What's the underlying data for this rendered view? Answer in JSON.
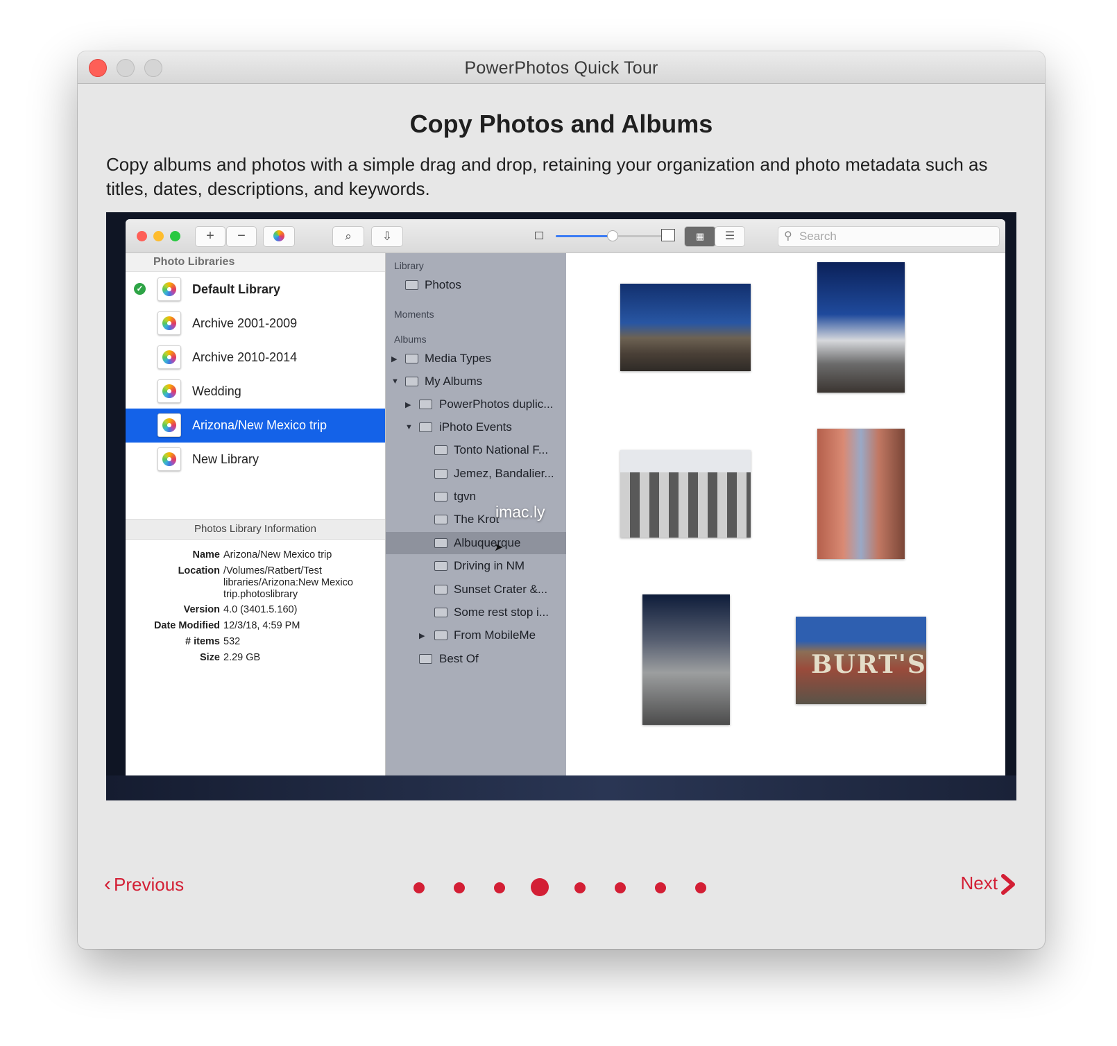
{
  "window": {
    "title": "PowerPhotos Quick Tour"
  },
  "page": {
    "heading": "Copy Photos and Albums",
    "description": "Copy albums and photos with a simple drag and drop, retaining your organization and photo metadata such as titles, dates, descriptions, and keywords."
  },
  "screenshot": {
    "search_placeholder": "Search",
    "libraries_header": "Photo Libraries",
    "libraries": [
      {
        "name": "Default Library",
        "default": true
      },
      {
        "name": "Archive 2001-2009"
      },
      {
        "name": "Archive 2010-2014"
      },
      {
        "name": "Wedding"
      },
      {
        "name": "Arizona/New Mexico trip",
        "selected": true
      },
      {
        "name": "New Library"
      }
    ],
    "info_header": "Photos Library Information",
    "info": {
      "name_label": "Name",
      "name": "Arizona/New Mexico trip",
      "location_label": "Location",
      "location": "/Volumes/Ratbert/Test libraries/Arizona:New Mexico trip.photoslibrary",
      "version_label": "Version",
      "version": "4.0 (3401.5.160)",
      "modified_label": "Date Modified",
      "modified": "12/3/18, 4:59 PM",
      "items_label": "# items",
      "items": "532",
      "size_label": "Size",
      "size": "2.29 GB"
    },
    "sidebar": {
      "library_section": "Library",
      "photos": "Photos",
      "moments_section": "Moments",
      "albums_section": "Albums",
      "items": [
        "Media Types",
        "My Albums",
        "PowerPhotos duplic...",
        "iPhoto Events",
        "Tonto National F...",
        "Jemez, Bandalier...",
        "tgvn",
        "The Krot",
        "Albuquerque",
        "Driving in NM",
        "Sunset Crater &...",
        "Some rest stop i...",
        "From MobileMe",
        "Best Of"
      ]
    },
    "watermark": "imac.ly",
    "photo6_text": "BURT'S"
  },
  "nav": {
    "previous": "Previous",
    "next": "Next",
    "page_count": 8,
    "current_page": 4
  },
  "colors": {
    "accent": "#d31f35",
    "selection": "#1462e8"
  }
}
